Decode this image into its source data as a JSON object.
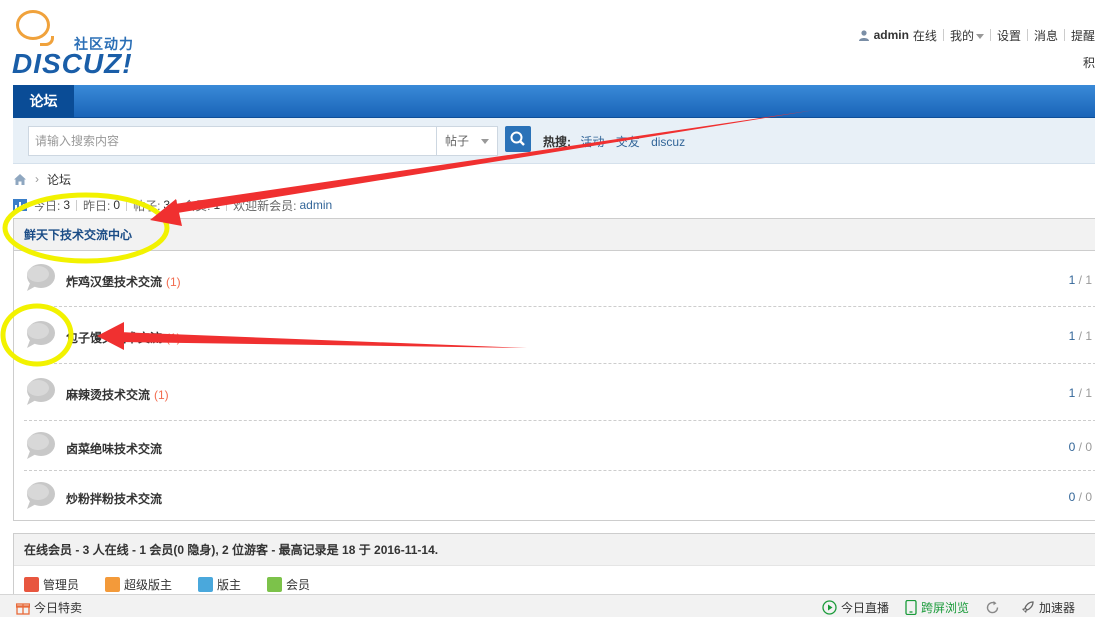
{
  "header": {
    "logo_sub": "社区动力",
    "logo_main": "DISCUZ!",
    "username": "admin",
    "online_status": "在线",
    "my": "我的",
    "settings": "设置",
    "messages": "消息",
    "reminders": "提醒",
    "credits": "积"
  },
  "nav": {
    "tab": "论坛"
  },
  "search": {
    "placeholder": "请输入搜索内容",
    "type": "帖子",
    "hot_label": "热搜:",
    "hot_words": [
      "活动",
      "交友",
      "discuz"
    ]
  },
  "breadcrumb": {
    "current": "论坛"
  },
  "stats": {
    "today_label": "今日:",
    "today": "3",
    "yesterday_label": "昨日:",
    "yesterday": "0",
    "posts_label": "帖子:",
    "posts": "3",
    "members_label": "会员:",
    "members": "1",
    "newest_label": "欢迎新会员:",
    "newest": "admin"
  },
  "group": {
    "title": "鲜天下技术交流中心",
    "forums": [
      {
        "name": "炸鸡汉堡技术交流",
        "new": "(1)",
        "threads": "1",
        "posts": "1"
      },
      {
        "name": "包子馒头技术交流",
        "new": "(1)",
        "threads": "1",
        "posts": "1"
      },
      {
        "name": "麻辣烫技术交流",
        "new": "(1)",
        "threads": "1",
        "posts": "1"
      },
      {
        "name": "卤菜绝味技术交流",
        "new": "",
        "threads": "0",
        "posts": "0"
      },
      {
        "name": "炒粉拌粉技术交流",
        "new": "",
        "threads": "0",
        "posts": "0"
      }
    ]
  },
  "online": {
    "summary": "在线会员 - 3 人在线 - 1 会员(0 隐身), 2 位游客 - 最高记录是 18 于 2016-11-14.",
    "legend": [
      {
        "label": "管理员",
        "color": "#e8563f"
      },
      {
        "label": "超级版主",
        "color": "#f39a3a"
      },
      {
        "label": "版主",
        "color": "#4aa8dc"
      },
      {
        "label": "会员",
        "color": "#7cc24a"
      }
    ]
  },
  "statusbar": {
    "deals": "今日特卖",
    "live": "今日直播",
    "cross_screen": "跨屏浏览",
    "accelerator": "加速器"
  }
}
